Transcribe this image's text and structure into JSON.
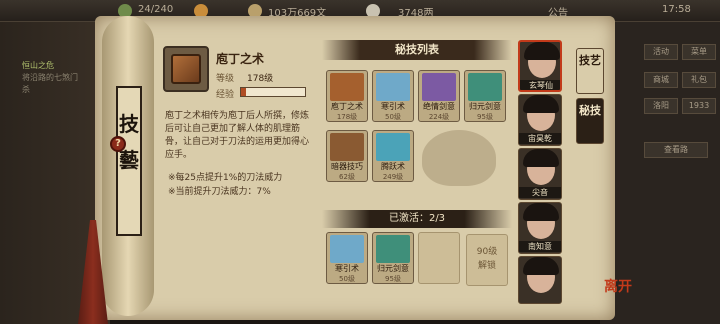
{
  "topbar": {
    "stat_a": "24/240",
    "stat_b": "103万669文",
    "stat_c": "3748两",
    "notice": "公告",
    "time": "17:58"
  },
  "left_panel": {
    "quest_title": "恒山之危",
    "quest_desc_1": "将沿路的七煞门",
    "quest_desc_2": "杀"
  },
  "right_panel": {
    "buttons": [
      "活动",
      "菜单",
      "商城",
      "礼包",
      "洛阳",
      "1933",
      "查看路"
    ]
  },
  "rod_label": "技藝",
  "help_label": "?",
  "detail": {
    "title": "庖丁之术",
    "level_label": "等级",
    "level_value": "178级",
    "exp_label": "经验",
    "exp_fraction": 0.08,
    "description": "庖丁之术相传为庖丁后人所撰，修炼后可让自己更加了解人体的肌理筋骨，让自己对于刀法的运用更加得心应手。",
    "bonus_1": "※每25点提升1%的刀法威力",
    "bonus_2": "※当前提升刀法威力：7%"
  },
  "list_title": "秘技列表",
  "skills": [
    {
      "name": "庖丁之术",
      "level": "178级",
      "color": "#a5602e"
    },
    {
      "name": "寒引术",
      "level": "50级",
      "color": "#6fa9c9"
    },
    {
      "name": "绝情剑意",
      "level": "224级",
      "color": "#7c5aa3"
    },
    {
      "name": "归元剑意",
      "level": "95级",
      "color": "#3f8f7a"
    },
    {
      "name": "暗器技巧",
      "level": "62级",
      "color": "#8a5a32"
    },
    {
      "name": "腾跃术",
      "level": "249级",
      "color": "#4ba3b8"
    }
  ],
  "activated_label": "已激活：2/3",
  "active_skills": [
    {
      "name": "寒引术",
      "level": "50级",
      "color": "#6fa9c9"
    },
    {
      "name": "归元剑意",
      "level": "95级",
      "color": "#3f8f7a"
    }
  ],
  "locked_slot": {
    "line1": "90级",
    "line2": "解锁"
  },
  "tabs": [
    "技艺",
    "秘技"
  ],
  "characters": [
    {
      "name": "玄琴仙",
      "selected": true
    },
    {
      "name": "宙昊乾",
      "selected": false
    },
    {
      "name": "尖音",
      "selected": false
    },
    {
      "name": "南知意",
      "selected": false
    },
    {
      "name": "",
      "selected": false
    }
  ],
  "seal_text": "离开"
}
